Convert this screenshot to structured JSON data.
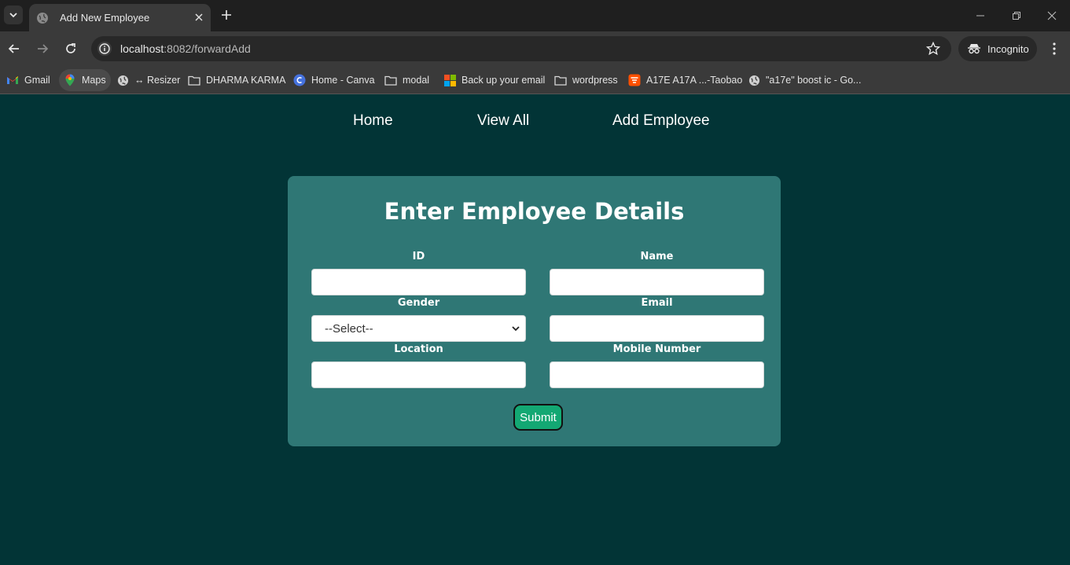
{
  "browser": {
    "tab_title": "Add New Employee",
    "url_host": "localhost",
    "url_rest": ":8082/forwardAdd",
    "profile_label": "Incognito"
  },
  "bookmarks": [
    {
      "label": "Gmail",
      "icon": "gmail-icon"
    },
    {
      "label": "Maps",
      "icon": "maps-icon"
    },
    {
      "label": "↔ Resizer",
      "icon": "globe-icon"
    },
    {
      "label": "DHARMA KARMA",
      "icon": "folder-icon"
    },
    {
      "label": "Home - Canva",
      "icon": "canva-icon"
    },
    {
      "label": "modal",
      "icon": "folder-icon"
    },
    {
      "label": "Back up your email",
      "icon": "microsoft-icon"
    },
    {
      "label": "wordpress",
      "icon": "folder-icon"
    },
    {
      "label": "A17E A17A ...-Taobao",
      "icon": "taobao-icon"
    },
    {
      "label": "\"a17e\" boost ic - Go...",
      "icon": "globe-icon"
    }
  ],
  "nav": {
    "home": "Home",
    "view_all": "View All",
    "add_employee": "Add Employee"
  },
  "form": {
    "heading": "Enter Employee Details",
    "id_label": "ID",
    "name_label": "Name",
    "gender_label": "Gender",
    "gender_selected": "--Select--",
    "email_label": "Email",
    "location_label": "Location",
    "mobile_label": "Mobile Number",
    "submit_label": "Submit"
  },
  "colors": {
    "page_background": "#023436",
    "card_background": "#2f7775",
    "submit_button": "#13a873"
  }
}
